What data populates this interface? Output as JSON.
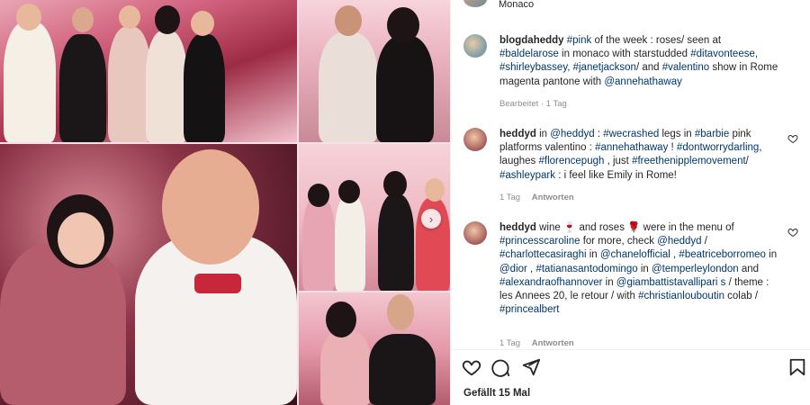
{
  "header": {
    "location": "Monaco"
  },
  "caption": {
    "username": "blogdaheddy",
    "segments": [
      {
        "t": " ",
        "tag": false
      },
      {
        "t": "#pink",
        "tag": true
      },
      {
        "t": " of the week : roses/ seen at ",
        "tag": false
      },
      {
        "t": "#baldelarose",
        "tag": true
      },
      {
        "t": " in monaco with starstudded ",
        "tag": false
      },
      {
        "t": "#ditavonteese",
        "tag": true
      },
      {
        "t": ", ",
        "tag": false
      },
      {
        "t": "#shirleybassey",
        "tag": true
      },
      {
        "t": ", ",
        "tag": false
      },
      {
        "t": "#janetjackson",
        "tag": true
      },
      {
        "t": "/ and ",
        "tag": false
      },
      {
        "t": "#valentino",
        "tag": true
      },
      {
        "t": " show in Rome magenta pantone with ",
        "tag": false
      },
      {
        "t": "@annehathaway",
        "tag": true
      }
    ],
    "meta": "Bearbeitet · 1 Tag"
  },
  "comments": [
    {
      "username": "heddyd",
      "segments": [
        {
          "t": " in ",
          "tag": false
        },
        {
          "t": "@heddyd",
          "tag": true
        },
        {
          "t": " : ",
          "tag": false
        },
        {
          "t": "#wecrashed",
          "tag": true
        },
        {
          "t": " legs in ",
          "tag": false
        },
        {
          "t": "#barbie",
          "tag": true
        },
        {
          "t": " pink platforms valentino : ",
          "tag": false
        },
        {
          "t": "#annehathaway",
          "tag": true
        },
        {
          "t": " ! ",
          "tag": false
        },
        {
          "t": "#dontworrydarling",
          "tag": true
        },
        {
          "t": ", laughes ",
          "tag": false
        },
        {
          "t": "#florencepugh",
          "tag": true
        },
        {
          "t": " , just ",
          "tag": false
        },
        {
          "t": "#freethenipplemovement",
          "tag": true
        },
        {
          "t": "/ ",
          "tag": false
        },
        {
          "t": "#ashleypark",
          "tag": true
        },
        {
          "t": " : i feel like Emily in Rome!",
          "tag": false
        }
      ],
      "time": "1 Tag",
      "reply_label": "Antworten"
    },
    {
      "username": "heddyd",
      "segments": [
        {
          "t": " wine 🍷 and roses 🌹 were in the menu of ",
          "tag": false
        },
        {
          "t": "#princesscaroline",
          "tag": true
        },
        {
          "t": " for more, check ",
          "tag": false
        },
        {
          "t": "@heddyd",
          "tag": true
        },
        {
          "t": " / ",
          "tag": false
        },
        {
          "t": "#charlottecasiraghi",
          "tag": true
        },
        {
          "t": " in ",
          "tag": false
        },
        {
          "t": "@chanelofficial",
          "tag": true
        },
        {
          "t": " , ",
          "tag": false
        },
        {
          "t": "#beatriceborromeo",
          "tag": true
        },
        {
          "t": " in ",
          "tag": false
        },
        {
          "t": "@dior",
          "tag": true
        },
        {
          "t": " , ",
          "tag": false
        },
        {
          "t": "#tatianasantodomingo",
          "tag": true
        },
        {
          "t": " in ",
          "tag": false
        },
        {
          "t": "@temperleylondon",
          "tag": true
        },
        {
          "t": " and ",
          "tag": false
        },
        {
          "t": "#alexandraofhannover",
          "tag": true
        },
        {
          "t": " in ",
          "tag": false
        },
        {
          "t": "@giambattistavallipari s",
          "tag": true
        },
        {
          "t": " / theme : les Annees 20, le retour / with ",
          "tag": false
        },
        {
          "t": "#christianlouboutin",
          "tag": true
        },
        {
          "t": " colab / ",
          "tag": false
        },
        {
          "t": "#princealbert",
          "tag": true
        }
      ],
      "time": "1 Tag",
      "reply_label": "Antworten"
    }
  ],
  "actions": {
    "likes": "Gefällt 15 Mal",
    "icons": [
      "heart-icon",
      "comment-icon",
      "share-icon",
      "bookmark-icon"
    ]
  },
  "colors": {
    "link": "#00376b",
    "text": "#262626",
    "muted": "#8e8e8e"
  }
}
